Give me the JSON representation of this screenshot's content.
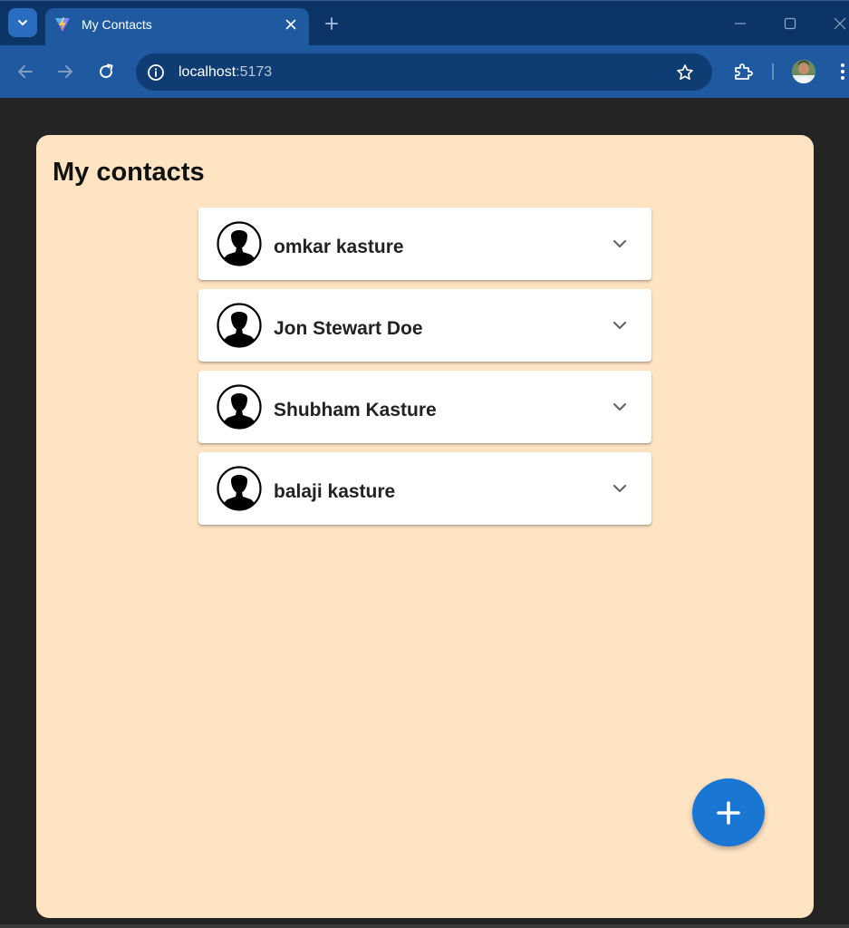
{
  "browser": {
    "tab": {
      "title": "My Contacts"
    },
    "address_bar": {
      "host": "localhost",
      "port": ":5173"
    }
  },
  "page": {
    "title": "My contacts",
    "contacts": [
      {
        "name": "omkar kasture"
      },
      {
        "name": "Jon Stewart Doe"
      },
      {
        "name": "Shubham Kasture"
      },
      {
        "name": "balaji kasture"
      }
    ],
    "fab_icon": "plus-icon"
  },
  "colors": {
    "card_background": "#ffe4c4",
    "fab": "#1976d2",
    "browser_frame": "#1f5aa0"
  }
}
